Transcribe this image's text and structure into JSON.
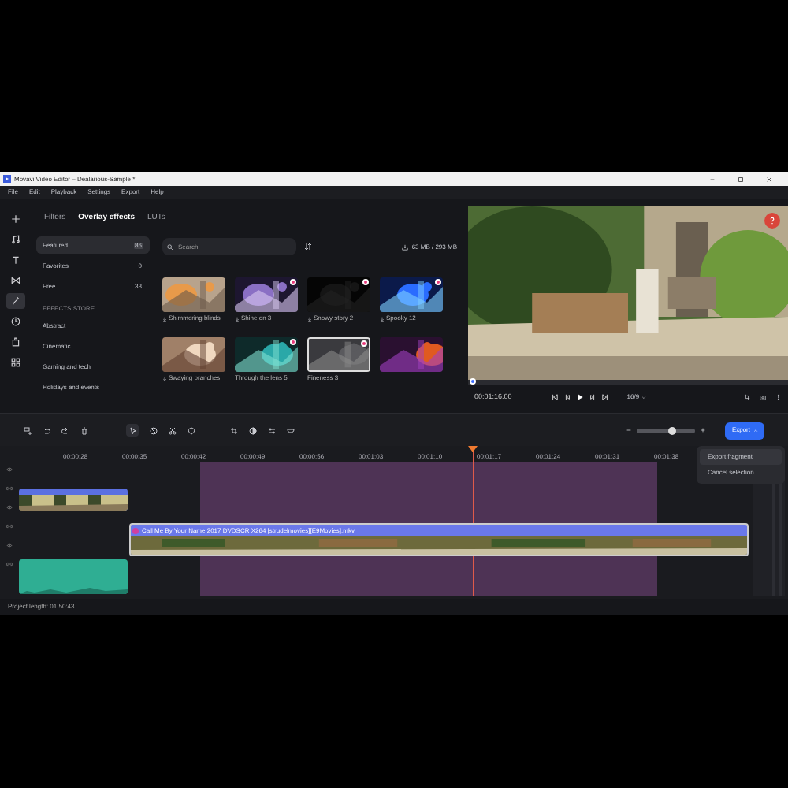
{
  "window": {
    "title": "Movavi Video Editor – Dealarious-Sample *"
  },
  "menu": [
    "File",
    "Edit",
    "Playback",
    "Settings",
    "Export",
    "Help"
  ],
  "rail": [
    {
      "selected": false
    },
    {
      "selected": false
    },
    {
      "selected": false
    },
    {
      "selected": false
    },
    {
      "selected": true
    },
    {
      "selected": false
    },
    {
      "selected": false
    },
    {
      "selected": false
    }
  ],
  "tabs": [
    {
      "label": "Filters",
      "selected": false
    },
    {
      "label": "Overlay effects",
      "selected": true
    },
    {
      "label": "LUTs",
      "selected": false
    }
  ],
  "categories": [
    {
      "label": "Featured",
      "count": "86",
      "selected": true
    },
    {
      "label": "Favorites",
      "count": "0",
      "selected": false
    },
    {
      "label": "Free",
      "count": "33",
      "selected": false
    }
  ],
  "store_heading": "EFFECTS STORE",
  "store_items": [
    "Abstract",
    "Cinematic",
    "Gaming and tech",
    "Holidays and events"
  ],
  "search": {
    "placeholder": "Search"
  },
  "storage": "63 MB / 293 MB",
  "effects": [
    {
      "label": "Shimmering blinds",
      "badge": false,
      "download": true
    },
    {
      "label": "Shine on 3",
      "badge": true,
      "download": true
    },
    {
      "label": "Snowy story 2",
      "badge": true,
      "download": true
    },
    {
      "label": "Spooky 12",
      "badge": true,
      "download": true
    },
    {
      "label": "Swaying branches",
      "badge": false,
      "download": true
    },
    {
      "label": "Through the lens 5",
      "badge": true,
      "download": false
    },
    {
      "label": "Fineness 3",
      "badge": true,
      "download": false
    },
    {
      "badge": false,
      "download": false
    }
  ],
  "preview": {
    "timecode": "00:01:16.00",
    "aspect": "16/9"
  },
  "zoom": {
    "level": 0.6
  },
  "export": {
    "label": "Export",
    "menu": [
      "Export fragment",
      "Cancel selection"
    ]
  },
  "ruler": [
    "00:00:28",
    "00:00:35",
    "00:00:42",
    "00:00:49",
    "00:00:56",
    "00:01:03",
    "00:01:10",
    "00:01:17",
    "00:01:24",
    "00:01:31",
    "00:01:38"
  ],
  "clip_title": "Call Me By Your Name 2017 DVDSCR X264 [strudelmovies][E9Movies].mkv",
  "status": "Project length: 01:50:43"
}
